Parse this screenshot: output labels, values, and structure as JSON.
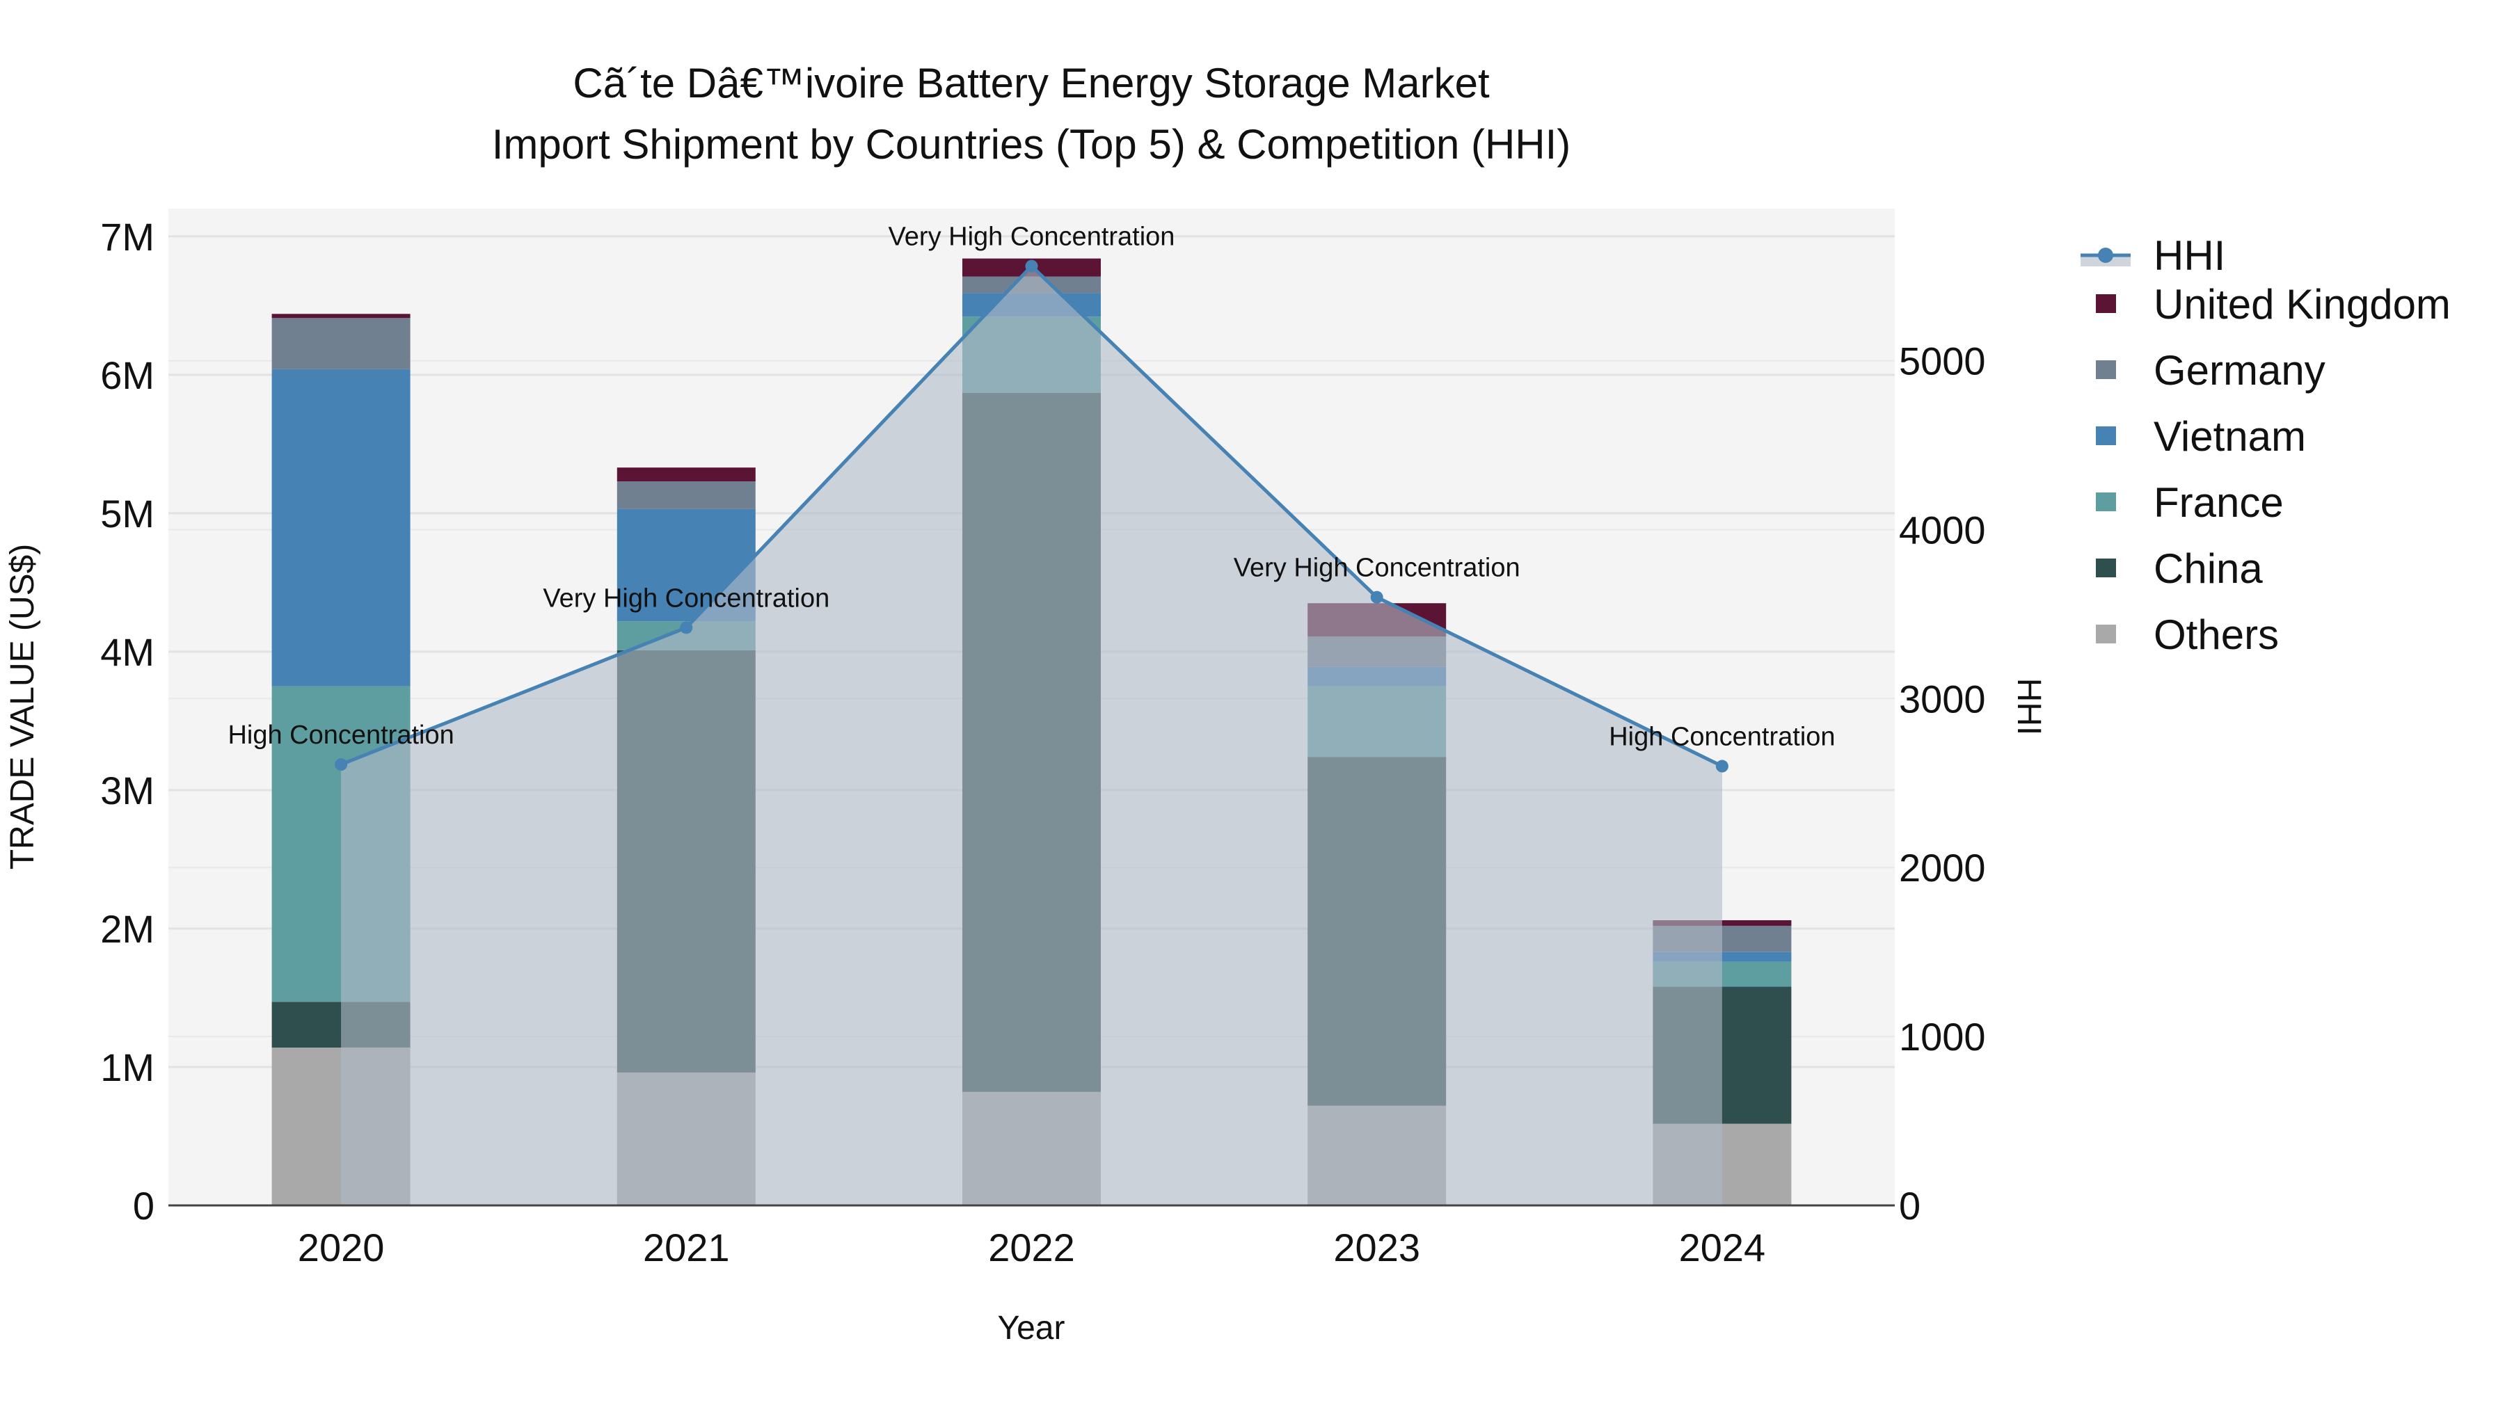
{
  "chart_data": {
    "type": "bar",
    "title_line1": "Cã´te Dâ€™ivoire Battery Energy Storage Market",
    "title_line2": "Import Shipment by Countries (Top 5) & Competition (HHI)",
    "xlabel": "Year",
    "ylabel": "TRADE VALUE (US$)",
    "y2label": "HHI",
    "categories": [
      "2020",
      "2021",
      "2022",
      "2023",
      "2024"
    ],
    "ylim": [
      0,
      7200000
    ],
    "y_ticks": [
      {
        "v": 0,
        "label": "0"
      },
      {
        "v": 1000000,
        "label": "1M"
      },
      {
        "v": 2000000,
        "label": "2M"
      },
      {
        "v": 3000000,
        "label": "3M"
      },
      {
        "v": 4000000,
        "label": "4M"
      },
      {
        "v": 5000000,
        "label": "5M"
      },
      {
        "v": 6000000,
        "label": "6M"
      },
      {
        "v": 7000000,
        "label": "7M"
      }
    ],
    "y2lim": [
      0,
      5900
    ],
    "y2_ticks": [
      {
        "v": 0,
        "label": "0"
      },
      {
        "v": 1000,
        "label": "1000"
      },
      {
        "v": 2000,
        "label": "2000"
      },
      {
        "v": 3000,
        "label": "3000"
      },
      {
        "v": 4000,
        "label": "4000"
      },
      {
        "v": 5000,
        "label": "5000"
      }
    ],
    "series": [
      {
        "name": "Others",
        "color": "#a9a9a9",
        "values": [
          1140000,
          960000,
          820000,
          720000,
          590000
        ]
      },
      {
        "name": "China",
        "color": "#2f4f4f",
        "values": [
          330000,
          3050000,
          5050000,
          2520000,
          990000
        ]
      },
      {
        "name": "France",
        "color": "#5f9ea0",
        "values": [
          2280000,
          210000,
          550000,
          510000,
          180000
        ]
      },
      {
        "name": "Vietnam",
        "color": "#4682b4",
        "values": [
          2290000,
          810000,
          170000,
          140000,
          70000
        ]
      },
      {
        "name": "Germany",
        "color": "#708090",
        "values": [
          370000,
          200000,
          120000,
          220000,
          190000
        ]
      },
      {
        "name": "United Kingdom",
        "color": "#5c1434",
        "values": [
          30000,
          100000,
          130000,
          240000,
          40000
        ]
      }
    ],
    "hhi": {
      "name": "HHI",
      "color": "#4682b4",
      "values": [
        2610,
        3420,
        5560,
        3600,
        2600
      ],
      "annotations": [
        "High Concentration",
        "Very High Concentration",
        "Very High Concentration",
        "Very High Concentration",
        "High Concentration"
      ]
    },
    "legend_order": [
      "HHI",
      "United Kingdom",
      "Germany",
      "Vietnam",
      "France",
      "China",
      "Others"
    ],
    "legend_placement": "right",
    "grid": true
  }
}
